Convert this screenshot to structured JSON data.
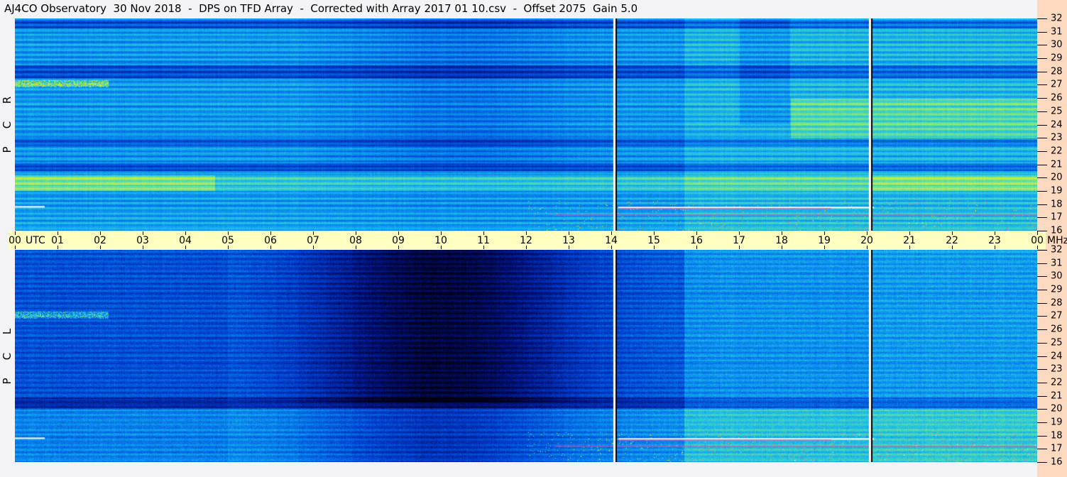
{
  "title": "AJ4CO Observatory  30 Nov 2018  -  DPS on TFD Array  -  Corrected with Array 2017 01 10.csv  -  Offset 2075  Gain 5.0",
  "chart_data": {
    "type": "heatmap",
    "title": "AJ4CO Observatory  30 Nov 2018  -  DPS on TFD Array  -  Corrected with Array 2017 01 10.csv  -  Offset 2075  Gain 5.0",
    "xlabel": "UTC",
    "ylabel": "MHz",
    "x_ticks": [
      "00",
      "01",
      "02",
      "03",
      "04",
      "05",
      "06",
      "07",
      "08",
      "09",
      "10",
      "11",
      "12",
      "13",
      "14",
      "15",
      "16",
      "17",
      "18",
      "19",
      "20",
      "21",
      "22",
      "23",
      "00"
    ],
    "y_ticks": [
      "32",
      "31",
      "30",
      "29",
      "28",
      "27",
      "26",
      "25",
      "24",
      "23",
      "22",
      "21",
      "20",
      "19",
      "18",
      "17",
      "16"
    ],
    "xlim_hours": [
      0,
      24
    ],
    "ylim_mhz": [
      16,
      32
    ],
    "panels": [
      {
        "label": [
          "R",
          "C",
          "P"
        ],
        "polarization": "RCP"
      },
      {
        "label": [
          "L",
          "C",
          "P"
        ],
        "polarization": "LCP"
      }
    ],
    "gap_markers_utc_hours": [
      14.1,
      20.1
    ],
    "colormap": [
      "#000010",
      "#00107a",
      "#0040d0",
      "#0a8cf0",
      "#20c0e8",
      "#60e0a0",
      "#c0f040",
      "#ffe000",
      "#ff3080",
      "#ffffff"
    ]
  },
  "colors": {
    "time_band": "#ffffc0",
    "freq_band": "#fcd9bf",
    "background": "#f4f4f6"
  }
}
